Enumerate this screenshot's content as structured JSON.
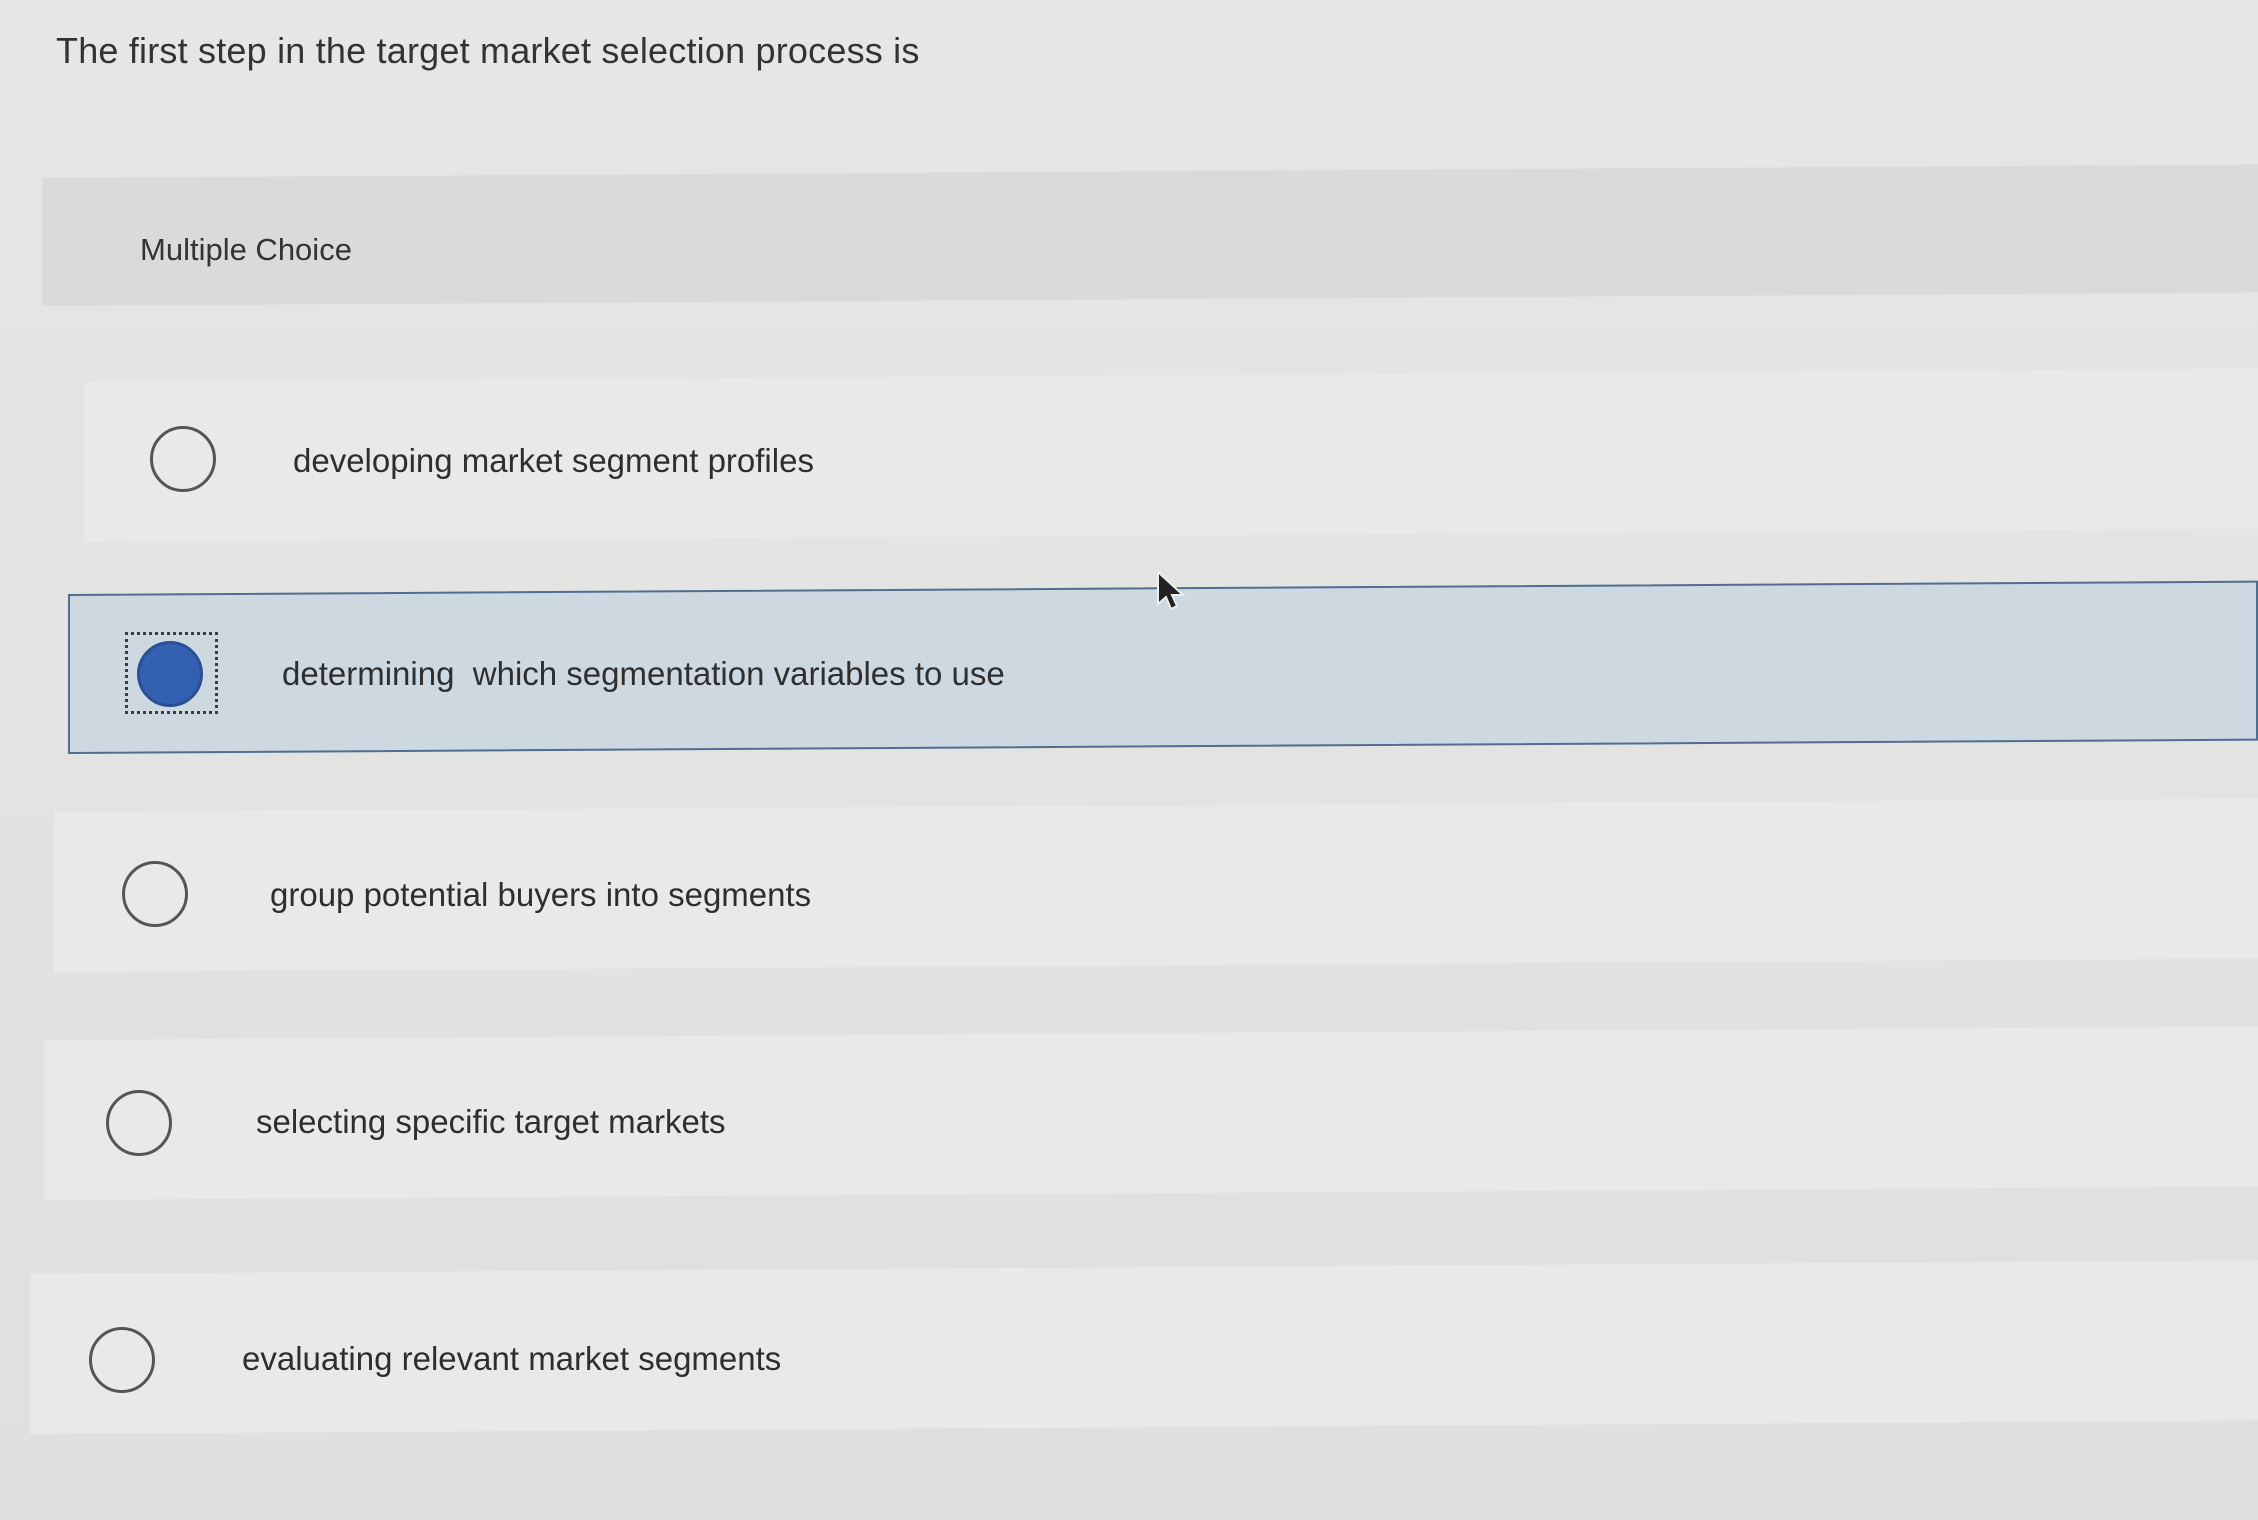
{
  "question": {
    "text": "The first step in the target market selection process is"
  },
  "section": {
    "label": "Multiple Choice"
  },
  "options": [
    {
      "label": "developing market segment profiles",
      "selected": false
    },
    {
      "label": "determining  which segmentation variables to use",
      "selected": true
    },
    {
      "label": "group potential buyers into segments",
      "selected": false
    },
    {
      "label": "selecting specific target markets",
      "selected": false
    },
    {
      "label": "evaluating relevant market segments",
      "selected": false
    }
  ],
  "colors": {
    "selected_fill": "#3360b0",
    "selected_row_bg": "#ced8e1",
    "selected_row_border": "#506e90"
  }
}
